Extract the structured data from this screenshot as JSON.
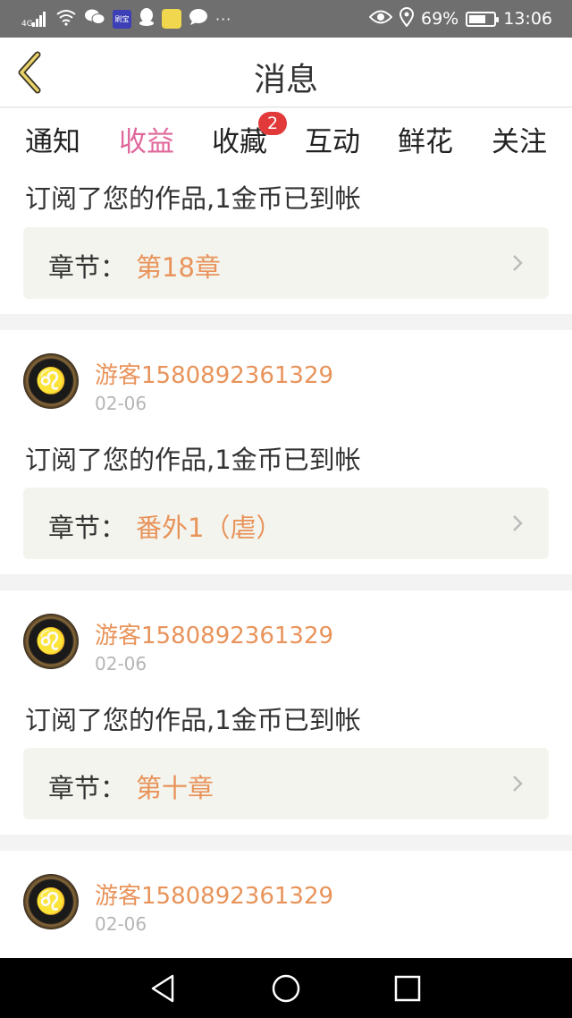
{
  "status_bar": {
    "network": "4G",
    "battery": "69%",
    "time": "13:06",
    "app_badge": "刷宝",
    "overflow": "···"
  },
  "header": {
    "title": "消息"
  },
  "tabs": [
    {
      "label": "通知",
      "active": false
    },
    {
      "label": "收益",
      "active": true
    },
    {
      "label": "收藏",
      "active": false,
      "badge": "2"
    },
    {
      "label": "互动",
      "active": false
    },
    {
      "label": "鲜花",
      "active": false
    },
    {
      "label": "关注",
      "active": false
    }
  ],
  "messages": [
    {
      "text": "订阅了您的作品,1金币已到帐",
      "chapter_label": "章节：",
      "chapter_name": "第18章"
    },
    {
      "user": "游客1580892361329",
      "date": "02-06",
      "text": "订阅了您的作品,1金币已到帐",
      "chapter_label": "章节：",
      "chapter_name": "番外1（虐）"
    },
    {
      "user": "游客1580892361329",
      "date": "02-06",
      "text": "订阅了您的作品,1金币已到帐",
      "chapter_label": "章节：",
      "chapter_name": "第十章"
    },
    {
      "user": "游客1580892361329",
      "date": "02-06"
    }
  ],
  "avatar_symbol": "♌",
  "colors": {
    "accent_pink": "#e0679b",
    "accent_orange": "#e8935a",
    "badge_red": "#e23a3a"
  }
}
